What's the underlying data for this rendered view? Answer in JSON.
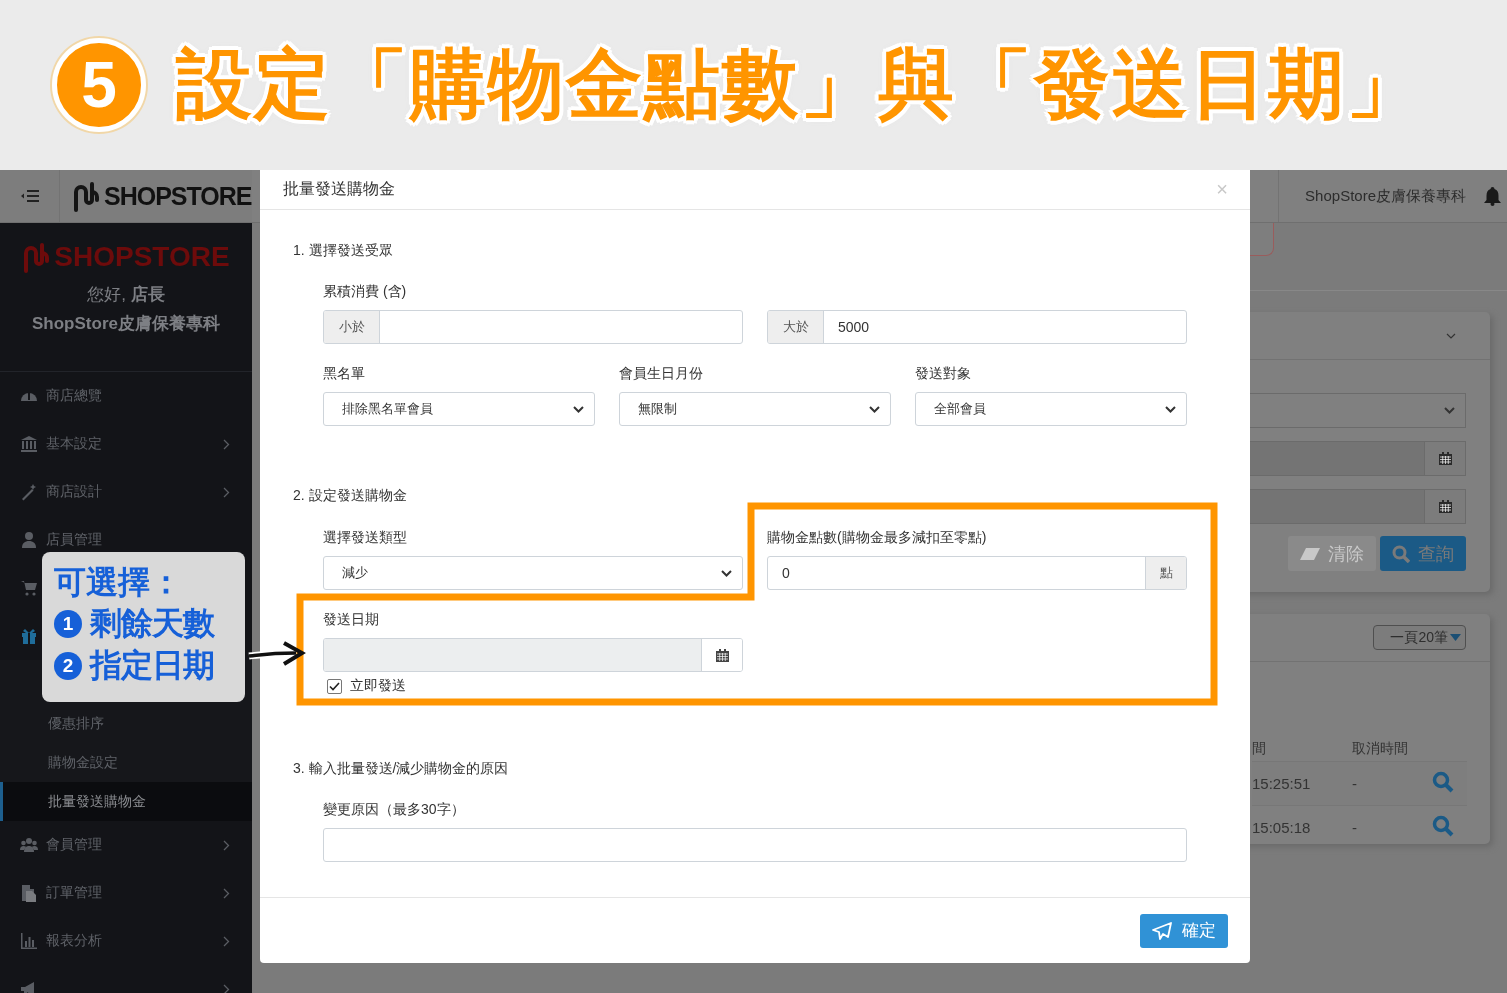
{
  "banner": {
    "step": "5",
    "title": "設定「購物金點數」與「發送日期」"
  },
  "topbar": {
    "logo": "SHOPSTORE",
    "store_name": "ShopStore皮膚保養專科"
  },
  "sidebar": {
    "logo": "SHOPSTORE",
    "greeting": "您好, **店長**",
    "store": "ShopStore皮膚保養專科",
    "items": [
      {
        "label": "商店總覽",
        "has_submenu": false
      },
      {
        "label": "基本設定",
        "has_submenu": true
      },
      {
        "label": "商店設計",
        "has_submenu": true
      },
      {
        "label": "店員管理",
        "has_submenu": false
      },
      {
        "has_submenu": false
      },
      {
        "has_submenu": false,
        "children": [
          {
            "label": "優惠排序",
            "selected": false
          },
          {
            "label": "購物金設定",
            "selected": false
          },
          {
            "label": "批量發送購物金",
            "selected": true
          }
        ]
      },
      {
        "label": "會員管理",
        "has_submenu": true
      },
      {
        "label": "訂單管理",
        "has_submenu": true
      },
      {
        "label": "報表分析",
        "has_submenu": true
      },
      {
        "has_submenu": true
      }
    ]
  },
  "background_page": {
    "buttons": [
      {
        "label": "清除",
        "disabled": true
      },
      {
        "label": "查詢",
        "disabled": false
      }
    ],
    "page_size": "一頁20筆",
    "columns": [
      "間",
      "取消時間"
    ],
    "rows": [
      {
        "cells": [
          "15:25:51",
          "-"
        ]
      },
      {
        "cells": [
          "15:05:18",
          "-"
        ]
      }
    ]
  },
  "modal": {
    "title": "批量發送購物金",
    "close": "×",
    "section1": {
      "heading": "1. 選擇發送受眾",
      "spend_label": "累積消費 (含)",
      "spend_min": {
        "prefix": "小於"
      },
      "spend_max": {
        "prefix": "大於",
        "value": "5000"
      },
      "selects": [
        {
          "label": "黑名單",
          "value": "排除黑名單會員"
        },
        {
          "label": "會員生日月份",
          "value": "無限制"
        },
        {
          "label": "發送對象",
          "value": "全部會員"
        }
      ]
    },
    "section2": {
      "heading": "2. 設定發送購物金",
      "type_select": {
        "label": "選擇發送類型",
        "value": "減少"
      },
      "points": {
        "label": "購物金點數(購物金最多減扣至零點)",
        "value": "0",
        "suffix": "點"
      },
      "date": {
        "label": "發送日期",
        "disabled": true
      },
      "send_now": {
        "label": "立即發送",
        "checked": true
      }
    },
    "section3": {
      "heading": "3. 輸入批量發送/減少購物金的原因",
      "reason_label": "變更原因（最多30字）"
    },
    "submit": "確定"
  },
  "callout": {
    "title": "可選擇：",
    "options": [
      {
        "number": "1",
        "label": "剩餘天數"
      },
      {
        "number": "2",
        "label": "指定日期"
      }
    ]
  }
}
